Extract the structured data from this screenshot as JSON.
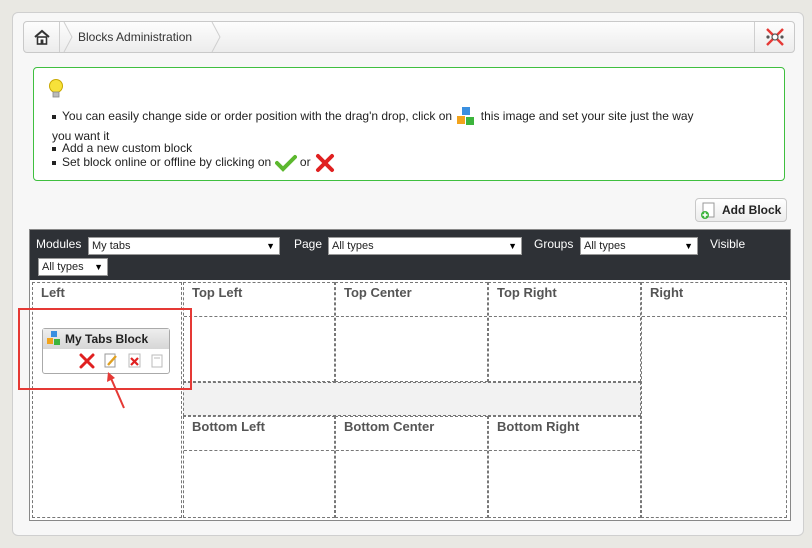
{
  "header": {
    "breadcrumb": "Blocks Administration",
    "home_icon": "home-icon",
    "logo_icon": "logo-icon"
  },
  "notice": {
    "line1_before": "You can easily change side or order position with the drag'n drop, click on",
    "line1_after": "this image and set your site just the way",
    "line1_wrap": "you want it",
    "line2": "Add a new custom block",
    "line3_before": "Set block online or offline by clicking on",
    "line3_or": "or"
  },
  "toolbar": {
    "add_block_label": "Add Block"
  },
  "filters": {
    "modules_label": "Modules",
    "modules_value": "My tabs",
    "page_label": "Page",
    "page_value": "All types",
    "groups_label": "Groups",
    "groups_value": "All types",
    "visible_label": "Visible",
    "visible_value": "All types"
  },
  "zones": {
    "left": "Left",
    "top_left": "Top Left",
    "top_center": "Top Center",
    "top_right": "Top Right",
    "right": "Right",
    "bottom_left": "Bottom Left",
    "bottom_center": "Bottom Center",
    "bottom_right": "Bottom Right"
  },
  "block": {
    "title": "My Tabs Block"
  },
  "colors": {
    "notice_border": "#3fbf3f",
    "filter_bar": "#2e3136",
    "highlight": "#e53935"
  }
}
